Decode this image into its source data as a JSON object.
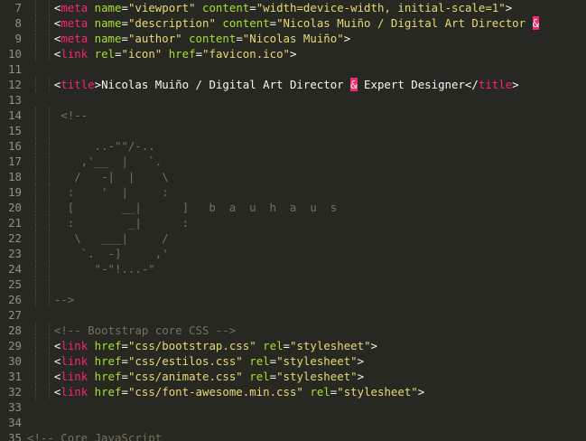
{
  "editor": {
    "language": "HTML",
    "theme": "Monokai",
    "colors": {
      "background": "#272822",
      "tag": "#f92672",
      "attribute": "#a6e22e",
      "string": "#e6db74",
      "comment": "#75715e",
      "text": "#f8f8f2",
      "gutter": "#8f908a"
    },
    "lines": [
      {
        "num": "7",
        "indent": 2,
        "tokens": [
          [
            "p",
            "<"
          ],
          [
            "t",
            "meta"
          ],
          [
            "p",
            " "
          ],
          [
            "a",
            "name"
          ],
          [
            "p",
            "="
          ],
          [
            "s",
            "\"viewport\""
          ],
          [
            "p",
            " "
          ],
          [
            "a",
            "content"
          ],
          [
            "p",
            "="
          ],
          [
            "s",
            "\"width=device-width, initial-scale=1\""
          ],
          [
            "p",
            ">"
          ]
        ]
      },
      {
        "num": "8",
        "indent": 2,
        "tokens": [
          [
            "p",
            "<"
          ],
          [
            "t",
            "meta"
          ],
          [
            "p",
            " "
          ],
          [
            "a",
            "name"
          ],
          [
            "p",
            "="
          ],
          [
            "s",
            "\"description\""
          ],
          [
            "p",
            " "
          ],
          [
            "a",
            "content"
          ],
          [
            "p",
            "="
          ],
          [
            "s",
            "\"Nicolas Muiño / Digital Art Director "
          ],
          [
            "ent",
            "&"
          ]
        ]
      },
      {
        "num": "9",
        "indent": 2,
        "tokens": [
          [
            "p",
            "<"
          ],
          [
            "t",
            "meta"
          ],
          [
            "p",
            " "
          ],
          [
            "a",
            "name"
          ],
          [
            "p",
            "="
          ],
          [
            "s",
            "\"author\""
          ],
          [
            "p",
            " "
          ],
          [
            "a",
            "content"
          ],
          [
            "p",
            "="
          ],
          [
            "s",
            "\"Nicolas Muiño\""
          ],
          [
            "p",
            ">"
          ]
        ]
      },
      {
        "num": "10",
        "indent": 2,
        "tokens": [
          [
            "p",
            "<"
          ],
          [
            "t",
            "link"
          ],
          [
            "p",
            " "
          ],
          [
            "a",
            "rel"
          ],
          [
            "p",
            "="
          ],
          [
            "s",
            "\"icon\""
          ],
          [
            "p",
            " "
          ],
          [
            "a",
            "href"
          ],
          [
            "p",
            "="
          ],
          [
            "s",
            "\"favicon.ico\""
          ],
          [
            "p",
            ">"
          ]
        ]
      },
      {
        "num": "11",
        "indent": 0,
        "tokens": []
      },
      {
        "num": "12",
        "indent": 2,
        "tokens": [
          [
            "p",
            "<"
          ],
          [
            "t",
            "title"
          ],
          [
            "p",
            ">Nicolas Muiño / Digital Art Director "
          ],
          [
            "ent",
            "&"
          ],
          [
            "p",
            " Expert Designer</"
          ],
          [
            "t",
            "title"
          ],
          [
            "p",
            ">"
          ]
        ]
      },
      {
        "num": "13",
        "indent": 0,
        "tokens": []
      },
      {
        "num": "14",
        "indent": 2,
        "tokens": [
          [
            "c",
            " <!--"
          ]
        ]
      },
      {
        "num": "15",
        "indent": 2,
        "tokens": []
      },
      {
        "num": "16",
        "indent": 2,
        "tokens": [
          [
            "c",
            "      ..-\"\"/-.."
          ]
        ]
      },
      {
        "num": "17",
        "indent": 2,
        "tokens": [
          [
            "c",
            "    ,'__  |   `."
          ]
        ]
      },
      {
        "num": "18",
        "indent": 2,
        "tokens": [
          [
            "c",
            "   /   -|  |    \\"
          ]
        ]
      },
      {
        "num": "19",
        "indent": 2,
        "tokens": [
          [
            "c",
            "  :    '  |     :"
          ]
        ]
      },
      {
        "num": "20",
        "indent": 2,
        "tokens": [
          [
            "c",
            "  [       __|      ]   b  a  u  h  a  u  s"
          ]
        ]
      },
      {
        "num": "21",
        "indent": 2,
        "tokens": [
          [
            "c",
            "  :        _|      :"
          ]
        ]
      },
      {
        "num": "22",
        "indent": 2,
        "tokens": [
          [
            "c",
            "   \\   ___|     /"
          ]
        ]
      },
      {
        "num": "23",
        "indent": 2,
        "tokens": [
          [
            "c",
            "    `.  -]     ,'"
          ]
        ]
      },
      {
        "num": "24",
        "indent": 2,
        "tokens": [
          [
            "c",
            "      \"-\"!...-\""
          ]
        ]
      },
      {
        "num": "25",
        "indent": 2,
        "tokens": []
      },
      {
        "num": "26",
        "indent": 2,
        "tokens": [
          [
            "c",
            "-->"
          ]
        ]
      },
      {
        "num": "27",
        "indent": 0,
        "tokens": []
      },
      {
        "num": "28",
        "indent": 2,
        "tokens": [
          [
            "c",
            "<!-- Bootstrap core CSS -->"
          ]
        ]
      },
      {
        "num": "29",
        "indent": 2,
        "tokens": [
          [
            "p",
            "<"
          ],
          [
            "t",
            "link"
          ],
          [
            "p",
            " "
          ],
          [
            "a",
            "href"
          ],
          [
            "p",
            "="
          ],
          [
            "s",
            "\"css/bootstrap.css\""
          ],
          [
            "p",
            " "
          ],
          [
            "a",
            "rel"
          ],
          [
            "p",
            "="
          ],
          [
            "s",
            "\"stylesheet\""
          ],
          [
            "p",
            ">"
          ]
        ]
      },
      {
        "num": "30",
        "indent": 2,
        "tokens": [
          [
            "p",
            "<"
          ],
          [
            "t",
            "link"
          ],
          [
            "p",
            " "
          ],
          [
            "a",
            "href"
          ],
          [
            "p",
            "="
          ],
          [
            "s",
            "\"css/estilos.css\""
          ],
          [
            "p",
            " "
          ],
          [
            "a",
            "rel"
          ],
          [
            "p",
            "="
          ],
          [
            "s",
            "\"stylesheet\""
          ],
          [
            "p",
            ">"
          ]
        ]
      },
      {
        "num": "31",
        "indent": 2,
        "tokens": [
          [
            "p",
            "<"
          ],
          [
            "t",
            "link"
          ],
          [
            "p",
            " "
          ],
          [
            "a",
            "href"
          ],
          [
            "p",
            "="
          ],
          [
            "s",
            "\"css/animate.css\""
          ],
          [
            "p",
            " "
          ],
          [
            "a",
            "rel"
          ],
          [
            "p",
            "="
          ],
          [
            "s",
            "\"stylesheet\""
          ],
          [
            "p",
            ">"
          ]
        ]
      },
      {
        "num": "32",
        "indent": 2,
        "tokens": [
          [
            "p",
            "<"
          ],
          [
            "t",
            "link"
          ],
          [
            "p",
            " "
          ],
          [
            "a",
            "href"
          ],
          [
            "p",
            "="
          ],
          [
            "s",
            "\"css/font-awesome.min.css\""
          ],
          [
            "p",
            " "
          ],
          [
            "a",
            "rel"
          ],
          [
            "p",
            "="
          ],
          [
            "s",
            "\"stylesheet\""
          ],
          [
            "p",
            ">"
          ]
        ]
      },
      {
        "num": "33",
        "indent": 0,
        "tokens": []
      },
      {
        "num": "34",
        "indent": 0,
        "tokens": []
      },
      {
        "num": "35",
        "indent": 0,
        "tokens": [
          [
            "c",
            "<!-- Core JavaScript"
          ]
        ]
      }
    ]
  }
}
